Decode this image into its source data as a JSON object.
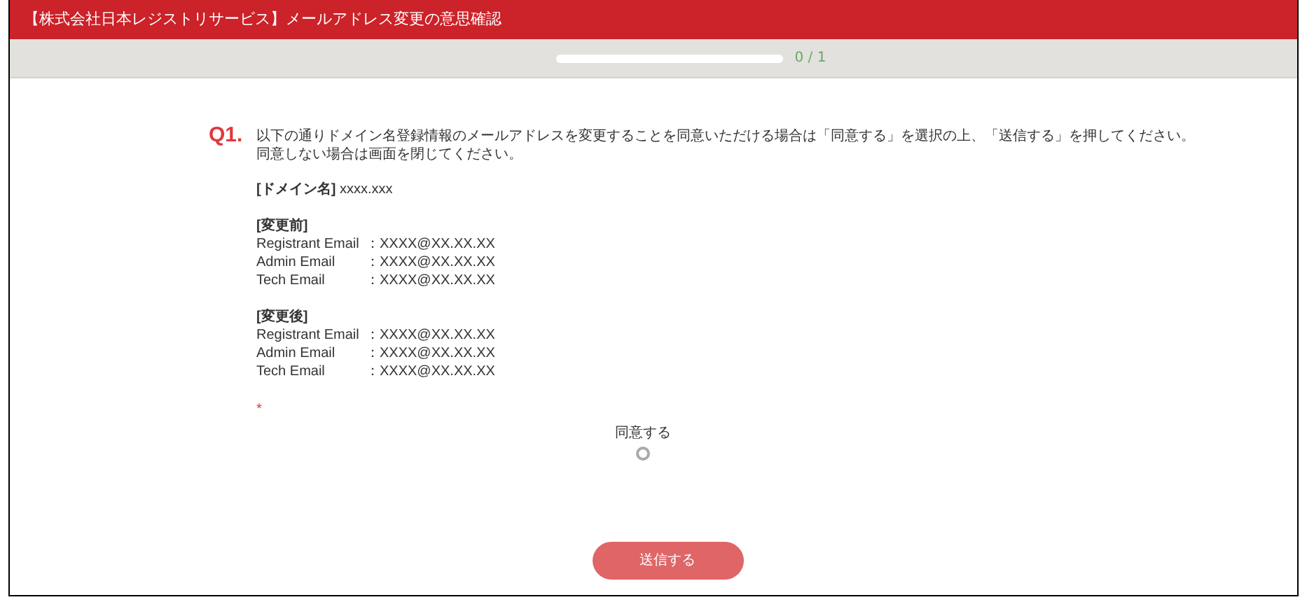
{
  "header": {
    "title": "【株式会社日本レジストリサービス】メールアドレス変更の意思確認"
  },
  "progress": {
    "level": 0,
    "text": "0 / 1"
  },
  "question": {
    "number": "Q1.",
    "paragraph": [
      "以下の通りドメイン名登録情報のメールアドレスを変更することを同意いただける場合は「同意する」を選択の上、「送信する」を押してください。",
      "同意しない場合は画面を閉じてください。"
    ],
    "domain": {
      "label": "[ドメイン名]",
      "value": "xxxx.xxx"
    },
    "sections": [
      {
        "heading": "[変更前]",
        "rows": [
          {
            "label": "Registrant Email",
            "value": "：XXXX@XX.XX.XX"
          },
          {
            "label": "Admin Email",
            "value": "：XXXX@XX.XX.XX"
          },
          {
            "label": "Tech Email",
            "value": "：XXXX@XX.XX.XX"
          }
        ]
      },
      {
        "heading": "[変更後]",
        "rows": [
          {
            "label": "Registrant Email",
            "value": "：XXXX@XX.XX.XX"
          },
          {
            "label": "Admin Email",
            "value": "：XXXX@XX.XX.XX"
          },
          {
            "label": "Tech Email",
            "value": "：XXXX@XX.XX.XX"
          }
        ]
      }
    ],
    "required_mark": "*",
    "options": [
      {
        "label": "同意する",
        "selected": false
      }
    ]
  },
  "submit_button": "送信する"
}
